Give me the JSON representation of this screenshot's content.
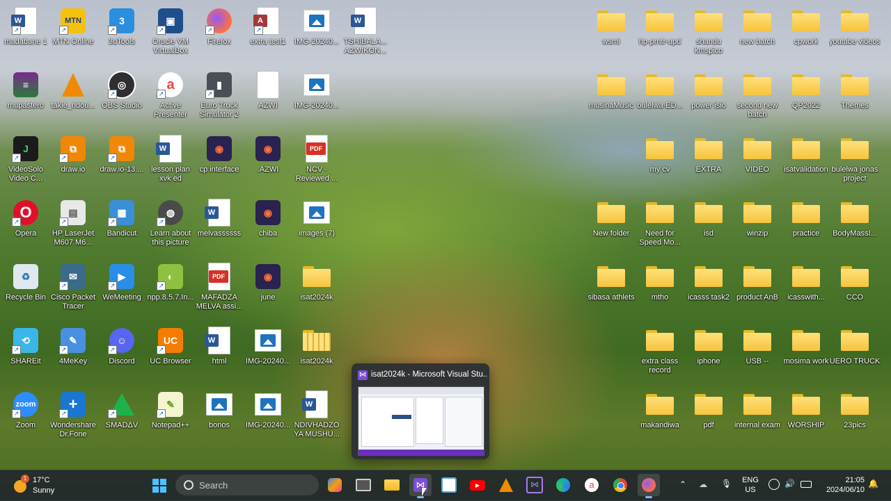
{
  "desktop": {
    "icons_left": [
      {
        "label": "madabane 1"
      },
      {
        "label": "MTN Online"
      },
      {
        "label": "3uTools"
      },
      {
        "label": "Oracle VM VirtualBox"
      },
      {
        "label": "Firefox"
      },
      {
        "label": "extra test1"
      },
      {
        "label": "IMG-20240..."
      },
      {
        "label": "TSHIBALA... AZWIKON..."
      },
      {
        "label": "mupastero"
      },
      {
        "label": "takie_ndou..."
      },
      {
        "label": "OBS Studio"
      },
      {
        "label": "Active Presenter"
      },
      {
        "label": "Euro Truck Simulator 2"
      },
      {
        "label": "AZWI"
      },
      {
        "label": "IMG-20240..."
      },
      {
        "label": "VideoSolo Video C..."
      },
      {
        "label": "draw.io"
      },
      {
        "label": "draw.io-13...."
      },
      {
        "label": "lesson plan xvk ed"
      },
      {
        "label": "cp interface"
      },
      {
        "label": ".AZWI"
      },
      {
        "label": "NCV - Reviewed ..."
      },
      {
        "label": "Opera"
      },
      {
        "label": "HP LaserJet M607 M6..."
      },
      {
        "label": "Bandicut"
      },
      {
        "label": "Learn about this picture"
      },
      {
        "label": "melvassssss"
      },
      {
        "label": "chiba"
      },
      {
        "label": "images (7)"
      },
      {
        "label": "Recycle Bin"
      },
      {
        "label": "Cisco Packet Tracer"
      },
      {
        "label": "WeMeeting"
      },
      {
        "label": "npp.8.5.7.In..."
      },
      {
        "label": "MAFADZA MELVA assi..."
      },
      {
        "label": "june"
      },
      {
        "label": "isat2024k"
      },
      {
        "label": "SHAREit"
      },
      {
        "label": "4MeKey"
      },
      {
        "label": "Discord"
      },
      {
        "label": "UC Browser"
      },
      {
        "label": "html"
      },
      {
        "label": "IMG-20240..."
      },
      {
        "label": "isat2024k"
      },
      {
        "label": "Zoom"
      },
      {
        "label": "Wondershare Dr.Fone"
      },
      {
        "label": "SMADΔV"
      },
      {
        "label": "Notepad++"
      },
      {
        "label": "bonos"
      },
      {
        "label": "IMG-20240..."
      },
      {
        "label": "NDIVHADZO YA MUSHU..."
      }
    ],
    "folders_right": [
      {
        "label": "wsmi"
      },
      {
        "label": "hp-prntr-upd"
      },
      {
        "label": "shandu kmspico"
      },
      {
        "label": "new batch"
      },
      {
        "label": "cpwork"
      },
      {
        "label": "youtube videos"
      },
      {
        "label": "musinaMusic"
      },
      {
        "label": "bulelwa-ED..."
      },
      {
        "label": "power isio"
      },
      {
        "label": "second new batch"
      },
      {
        "label": "QP2022"
      },
      {
        "label": "Themes"
      },
      {
        "label": "my cv"
      },
      {
        "label": "EXTRA"
      },
      {
        "label": "VIDEO"
      },
      {
        "label": "isatvalidation"
      },
      {
        "label": "bulelwa jonas project"
      },
      {
        "label": "New folder"
      },
      {
        "label": "Need for Speed Mo..."
      },
      {
        "label": "isd"
      },
      {
        "label": "winzip"
      },
      {
        "label": "practice"
      },
      {
        "label": "BodyMassI..."
      },
      {
        "label": "sibasa athlets"
      },
      {
        "label": "mtho"
      },
      {
        "label": "icasss task2"
      },
      {
        "label": "product AnB"
      },
      {
        "label": "icasswith..."
      },
      {
        "label": "CCO"
      },
      {
        "label": "extra class record"
      },
      {
        "label": "iphone"
      },
      {
        "label": "USB --"
      },
      {
        "label": "mosima work"
      },
      {
        "label": "UERO TRUCK"
      },
      {
        "label": "makandiwa"
      },
      {
        "label": "pdf"
      },
      {
        "label": "internal exam"
      },
      {
        "label": "WORSHIP"
      },
      {
        "label": "23pics"
      }
    ]
  },
  "taskbar_preview": {
    "title": "isat2024k - Microsoft Visual Stu..."
  },
  "taskbar": {
    "weather": {
      "temp": "17°C",
      "condition": "Sunny",
      "badge": "1"
    },
    "search_placeholder": "Search",
    "language": {
      "line1": "ENG",
      "line2": "US"
    },
    "clock": {
      "time": "21:05",
      "date": "2024/06/10"
    }
  }
}
